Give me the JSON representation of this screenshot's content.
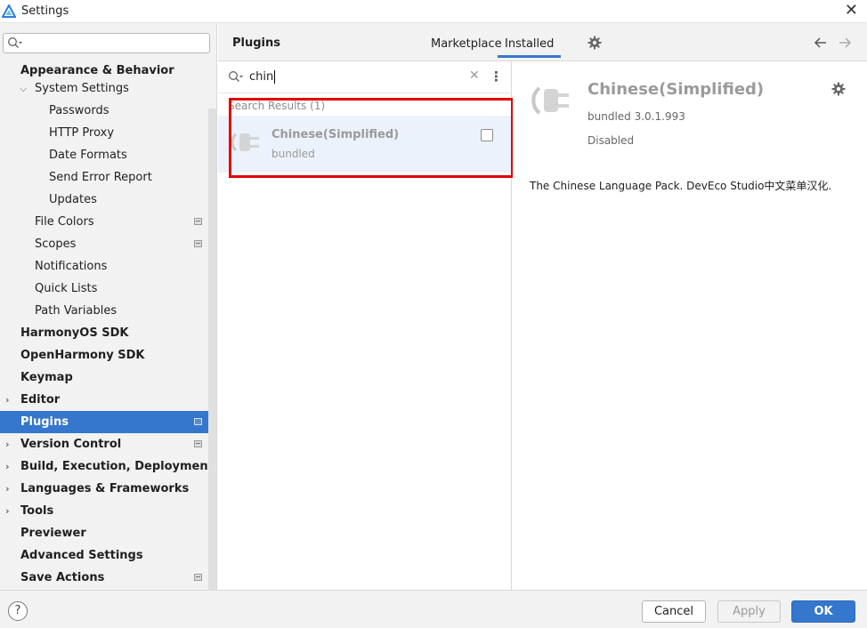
{
  "window": {
    "title": "Settings"
  },
  "sidebar": {
    "search": {
      "value": "",
      "placeholder": ""
    },
    "items": [
      {
        "label": "Appearance & Behavior"
      },
      {
        "label": "System Settings"
      },
      {
        "label": "Passwords"
      },
      {
        "label": "HTTP Proxy"
      },
      {
        "label": "Date Formats"
      },
      {
        "label": "Send Error Report"
      },
      {
        "label": "Updates"
      },
      {
        "label": "File Colors"
      },
      {
        "label": "Scopes"
      },
      {
        "label": "Notifications"
      },
      {
        "label": "Quick Lists"
      },
      {
        "label": "Path Variables"
      },
      {
        "label": "HarmonyOS SDK"
      },
      {
        "label": "OpenHarmony SDK"
      },
      {
        "label": "Keymap"
      },
      {
        "label": "Editor"
      },
      {
        "label": "Plugins"
      },
      {
        "label": "Version Control"
      },
      {
        "label": "Build, Execution, Deployment"
      },
      {
        "label": "Languages & Frameworks"
      },
      {
        "label": "Tools"
      },
      {
        "label": "Previewer"
      },
      {
        "label": "Advanced Settings"
      },
      {
        "label": "Save Actions"
      }
    ]
  },
  "header": {
    "title": "Plugins",
    "tabs": [
      {
        "label": "Marketplace"
      },
      {
        "label": "Installed"
      }
    ],
    "active_tab": "Installed"
  },
  "plugin_search": {
    "value": "chin"
  },
  "results": {
    "label": "Search Results (1)",
    "items": [
      {
        "name": "Chinese(Simplified)",
        "source": "bundled"
      }
    ]
  },
  "detail": {
    "name": "Chinese(Simplified)",
    "version": "bundled 3.0.1.993",
    "status": "Disabled",
    "description": "The Chinese Language Pack. DevEco Studio中文菜单汉化."
  },
  "footer": {
    "help": "?",
    "cancel": "Cancel",
    "apply": "Apply",
    "ok": "OK"
  },
  "colors": {
    "accent": "#3577cc",
    "highlight": "#e00000"
  }
}
